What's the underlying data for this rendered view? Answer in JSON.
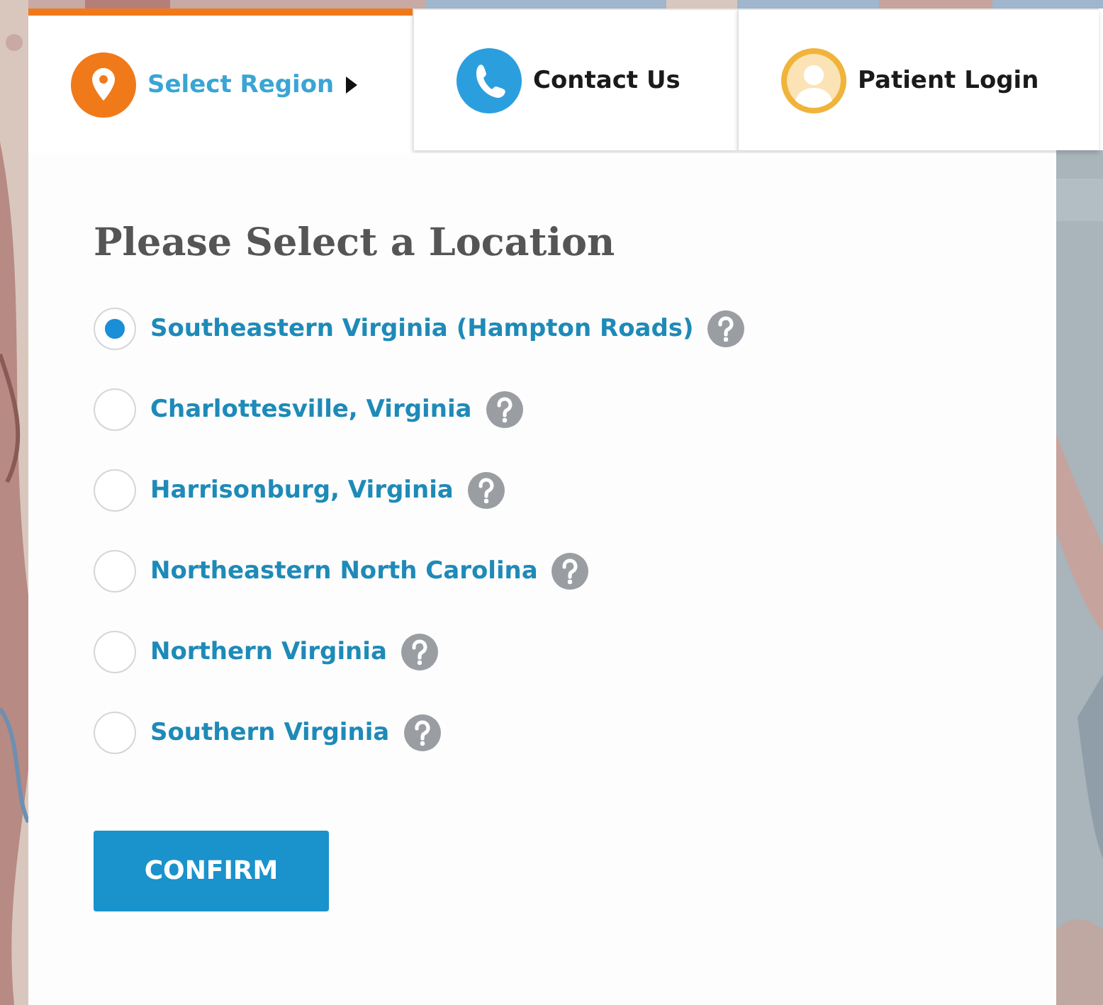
{
  "tabs": [
    {
      "label": "Select Region",
      "kind": "region",
      "selected": true
    },
    {
      "label": "Contact Us",
      "kind": "contact",
      "selected": false
    },
    {
      "label": "Patient Login",
      "kind": "login",
      "selected": false
    }
  ],
  "panel": {
    "title": "Please Select a Location",
    "options": [
      {
        "label": "Southeastern Virginia (Hampton Roads)",
        "selected": true
      },
      {
        "label": "Charlottesville, Virginia",
        "selected": false
      },
      {
        "label": "Harrisonburg, Virginia",
        "selected": false
      },
      {
        "label": "Northeastern North Carolina",
        "selected": false
      },
      {
        "label": "Northern Virginia",
        "selected": false
      },
      {
        "label": "Southern Virginia",
        "selected": false
      }
    ],
    "button": "CONFIRM"
  }
}
